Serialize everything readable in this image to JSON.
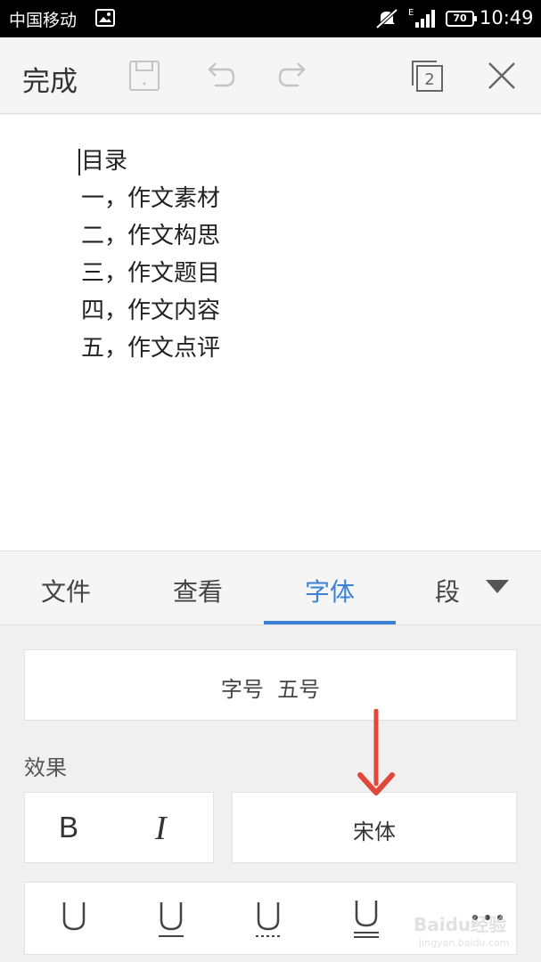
{
  "status_bar": {
    "carrier": "中国移动",
    "network": "E",
    "battery": "70",
    "time": "10:49"
  },
  "toolbar": {
    "done_label": "完成",
    "icons": [
      "save-icon",
      "undo-icon",
      "redo-icon",
      "windows-icon",
      "close-icon"
    ],
    "windows_count": "2"
  },
  "document": {
    "lines": [
      "目录",
      "一，作文素材",
      "二，作文构思",
      "三，作文题目",
      "四，作文内容",
      "五，作文点评"
    ]
  },
  "tabs": {
    "items": [
      "文件",
      "查看",
      "字体",
      "段"
    ],
    "active": "字体"
  },
  "font_panel": {
    "size_label": "字号  五号",
    "effects_label": "效果",
    "bold_label": "B",
    "italic_label": "I",
    "font_name": "宋体"
  },
  "watermark": {
    "brand": "Baidu经验",
    "url": "jingyan.baidu.com"
  },
  "colors": {
    "accent": "#3b82d6",
    "annotation_arrow": "#e0483a"
  }
}
